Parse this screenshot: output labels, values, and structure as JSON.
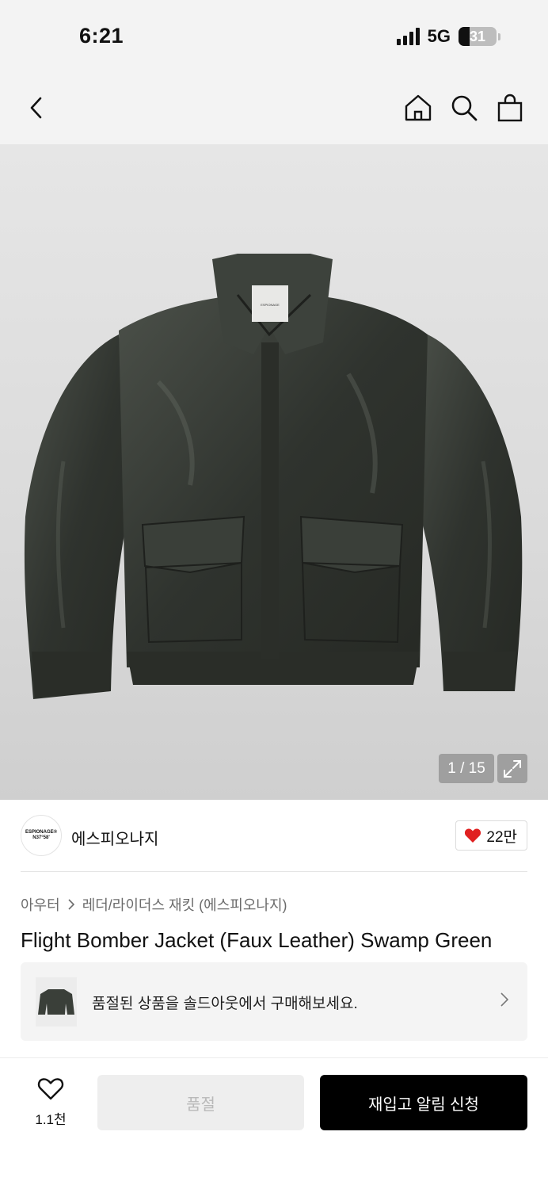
{
  "status": {
    "time": "6:21",
    "network": "5G",
    "battery": "31",
    "battery_level": 0.31
  },
  "nav": {
    "back_icon": "back-chevron-icon",
    "home_icon": "home-icon",
    "search_icon": "search-icon",
    "cart_icon": "shopping-bag-icon"
  },
  "gallery": {
    "counter": "1 / 15",
    "expand_icon": "expand-icon"
  },
  "brand": {
    "logo_line1": "ESPIONAGE®",
    "logo_line2": "N37°58'",
    "name": "에스피오나지",
    "likes": "22만",
    "like_color": "#e02020"
  },
  "breadcrumb": {
    "category": "아우터",
    "subcategory": "레더/라이더스 재킷 (에스피오나지)"
  },
  "product": {
    "title": "Flight Bomber Jacket (Faux Leather) Swamp Green"
  },
  "promo": {
    "text": "품절된 상품을 솔드아웃에서 구매해보세요."
  },
  "bottom": {
    "wish_count": "1.1천",
    "soldout_label": "품절",
    "restock_label": "재입고 알림 신청"
  }
}
